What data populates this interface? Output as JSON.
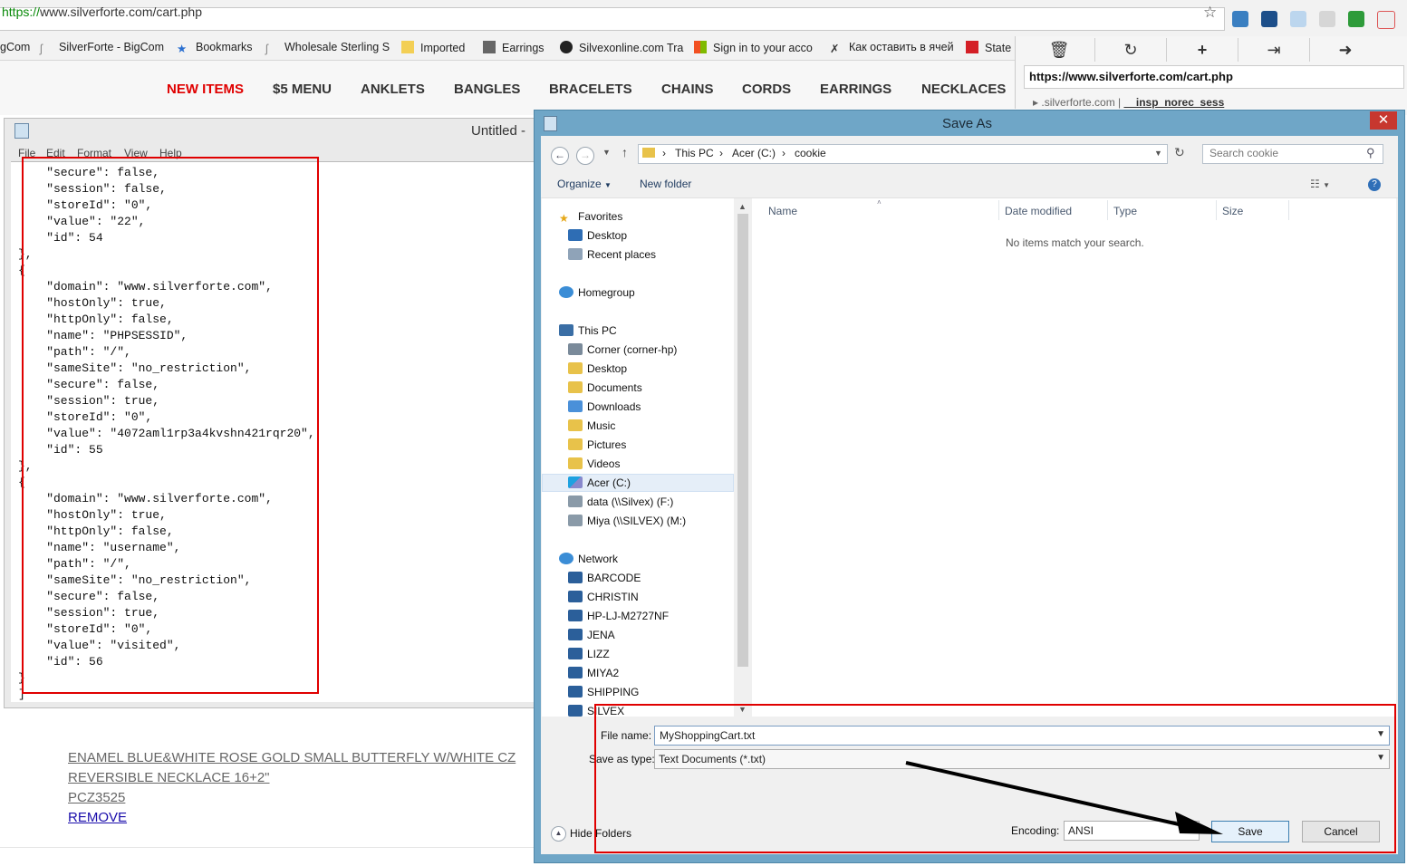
{
  "browser": {
    "url_proto": "https://",
    "url_rest": "www.silverforte.com/cart.php",
    "bookmarks": [
      "gCom",
      "SilverForte - BigCom",
      "Bookmarks",
      "Wholesale Sterling S",
      "Imported",
      "Earrings",
      "Silvexonline.com Tra",
      "Sign in to your acco",
      "Как оставить в ячей",
      "State"
    ]
  },
  "site": {
    "nav": [
      "NEW ITEMS",
      "$5 MENU",
      "ANKLETS",
      "BANGLES",
      "BRACELETS",
      "CHAINS",
      "CORDS",
      "EARRINGS",
      "NECKLACES"
    ],
    "product": {
      "title1": "ENAMEL BLUE&WHITE ROSE GOLD SMALL BUTTERFLY W/WHITE CZ",
      "title2": "REVERSIBLE NECKLACE 16+2\"",
      "sku": "PCZ3525",
      "remove": "REMOVE"
    }
  },
  "notepad": {
    "title": "Untitled -",
    "menu": [
      "File",
      "Edit",
      "Format",
      "View",
      "Help"
    ],
    "content": "    \"secure\": false,\n    \"session\": false,\n    \"storeId\": \"0\",\n    \"value\": \"22\",\n    \"id\": 54\n},\n{\n    \"domain\": \"www.silverforte.com\",\n    \"hostOnly\": true,\n    \"httpOnly\": false,\n    \"name\": \"PHPSESSID\",\n    \"path\": \"/\",\n    \"sameSite\": \"no_restriction\",\n    \"secure\": false,\n    \"session\": true,\n    \"storeId\": \"0\",\n    \"value\": \"4072aml1rp3a4kvshn421rqr20\",\n    \"id\": 55\n},\n{\n    \"domain\": \"www.silverforte.com\",\n    \"hostOnly\": true,\n    \"httpOnly\": false,\n    \"name\": \"username\",\n    \"path\": \"/\",\n    \"sameSite\": \"no_restriction\",\n    \"secure\": false,\n    \"session\": true,\n    \"storeId\": \"0\",\n    \"value\": \"visited\",\n    \"id\": 56\n}\n]"
  },
  "cookie_panel": {
    "url": "https://www.silverforte.com/cart.php",
    "row_domain": ".silverforte.com",
    "row_name": "__insp_norec_sess"
  },
  "dialog": {
    "title": "Save As",
    "breadcrumb": [
      "This PC",
      "Acer (C:)",
      "cookie"
    ],
    "search_placeholder": "Search cookie",
    "toolbar": {
      "organize": "Organize",
      "new_folder": "New folder"
    },
    "tree": {
      "favorites": "Favorites",
      "fav_items": [
        "Desktop",
        "Recent places"
      ],
      "homegroup": "Homegroup",
      "this_pc": "This PC",
      "pc_items": [
        "Corner (corner-hp)",
        "Desktop",
        "Documents",
        "Downloads",
        "Music",
        "Pictures",
        "Videos",
        "Acer (C:)",
        "data (\\\\Silvex) (F:)",
        "Miya (\\\\SILVEX) (M:)"
      ],
      "network": "Network",
      "net_items": [
        "BARCODE",
        "CHRISTIN",
        "HP-LJ-M2727NF",
        "JENA",
        "LIZZ",
        "MIYA2",
        "SHIPPING",
        "SILVEX"
      ]
    },
    "columns": [
      "Name",
      "Date modified",
      "Type",
      "Size"
    ],
    "empty_message": "No items match your search.",
    "file_name_label": "File name:",
    "file_name_value": "MyShoppingCart.txt",
    "save_type_label": "Save as type:",
    "save_type_value": "Text Documents (*.txt)",
    "hide_folders": "Hide Folders",
    "encoding_label": "Encoding:",
    "encoding_value": "ANSI",
    "save": "Save",
    "cancel": "Cancel"
  },
  "colors": {
    "nav_highlight": "#e00000",
    "annotation_red": "#e00000",
    "dialog_frame": "#6fa6c7"
  }
}
